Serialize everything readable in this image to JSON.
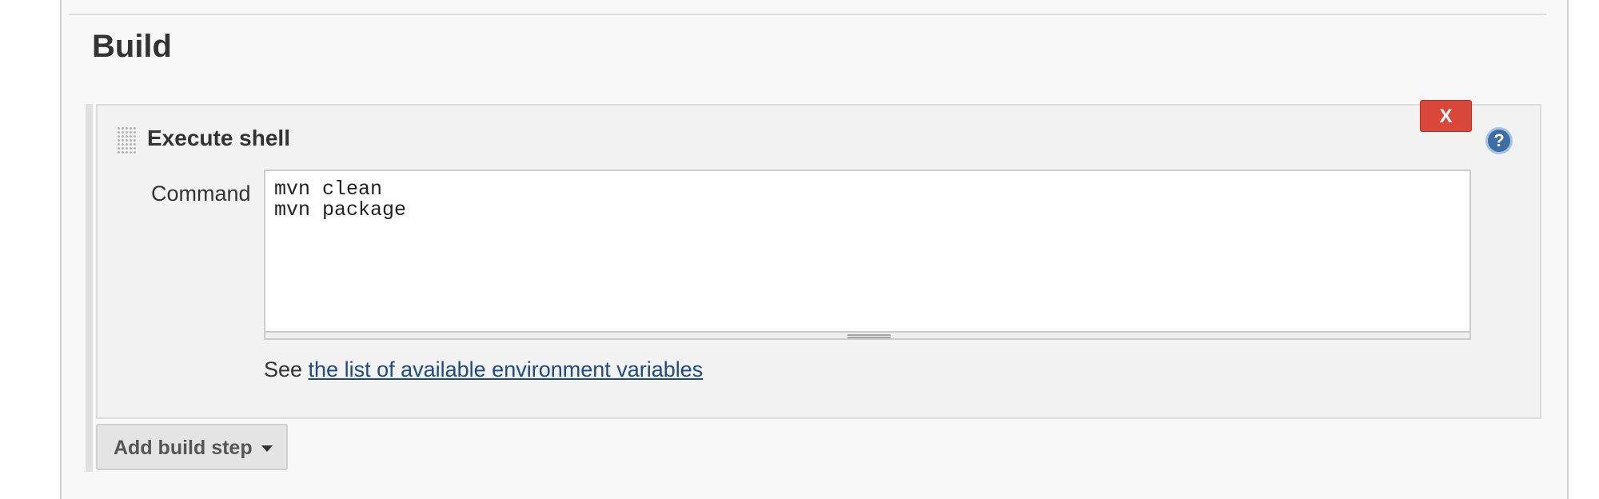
{
  "section": {
    "title": "Build"
  },
  "build_step": {
    "title": "Execute shell",
    "delete_label": "X",
    "help_glyph": "?",
    "command_label": "Command",
    "command_value": "mvn clean\nmvn package",
    "env_help_prefix": "See ",
    "env_help_link": "the list of available environment variables"
  },
  "actions": {
    "add_build_step_label": "Add build step"
  },
  "icons": {
    "drag": "drag-handle-icon",
    "help": "help-icon",
    "caret": "caret-down-icon",
    "resize": "resize-grip-icon"
  },
  "colors": {
    "delete_button": "#d9463a",
    "link": "#204a87",
    "help_icon": "#3c6ea5"
  }
}
